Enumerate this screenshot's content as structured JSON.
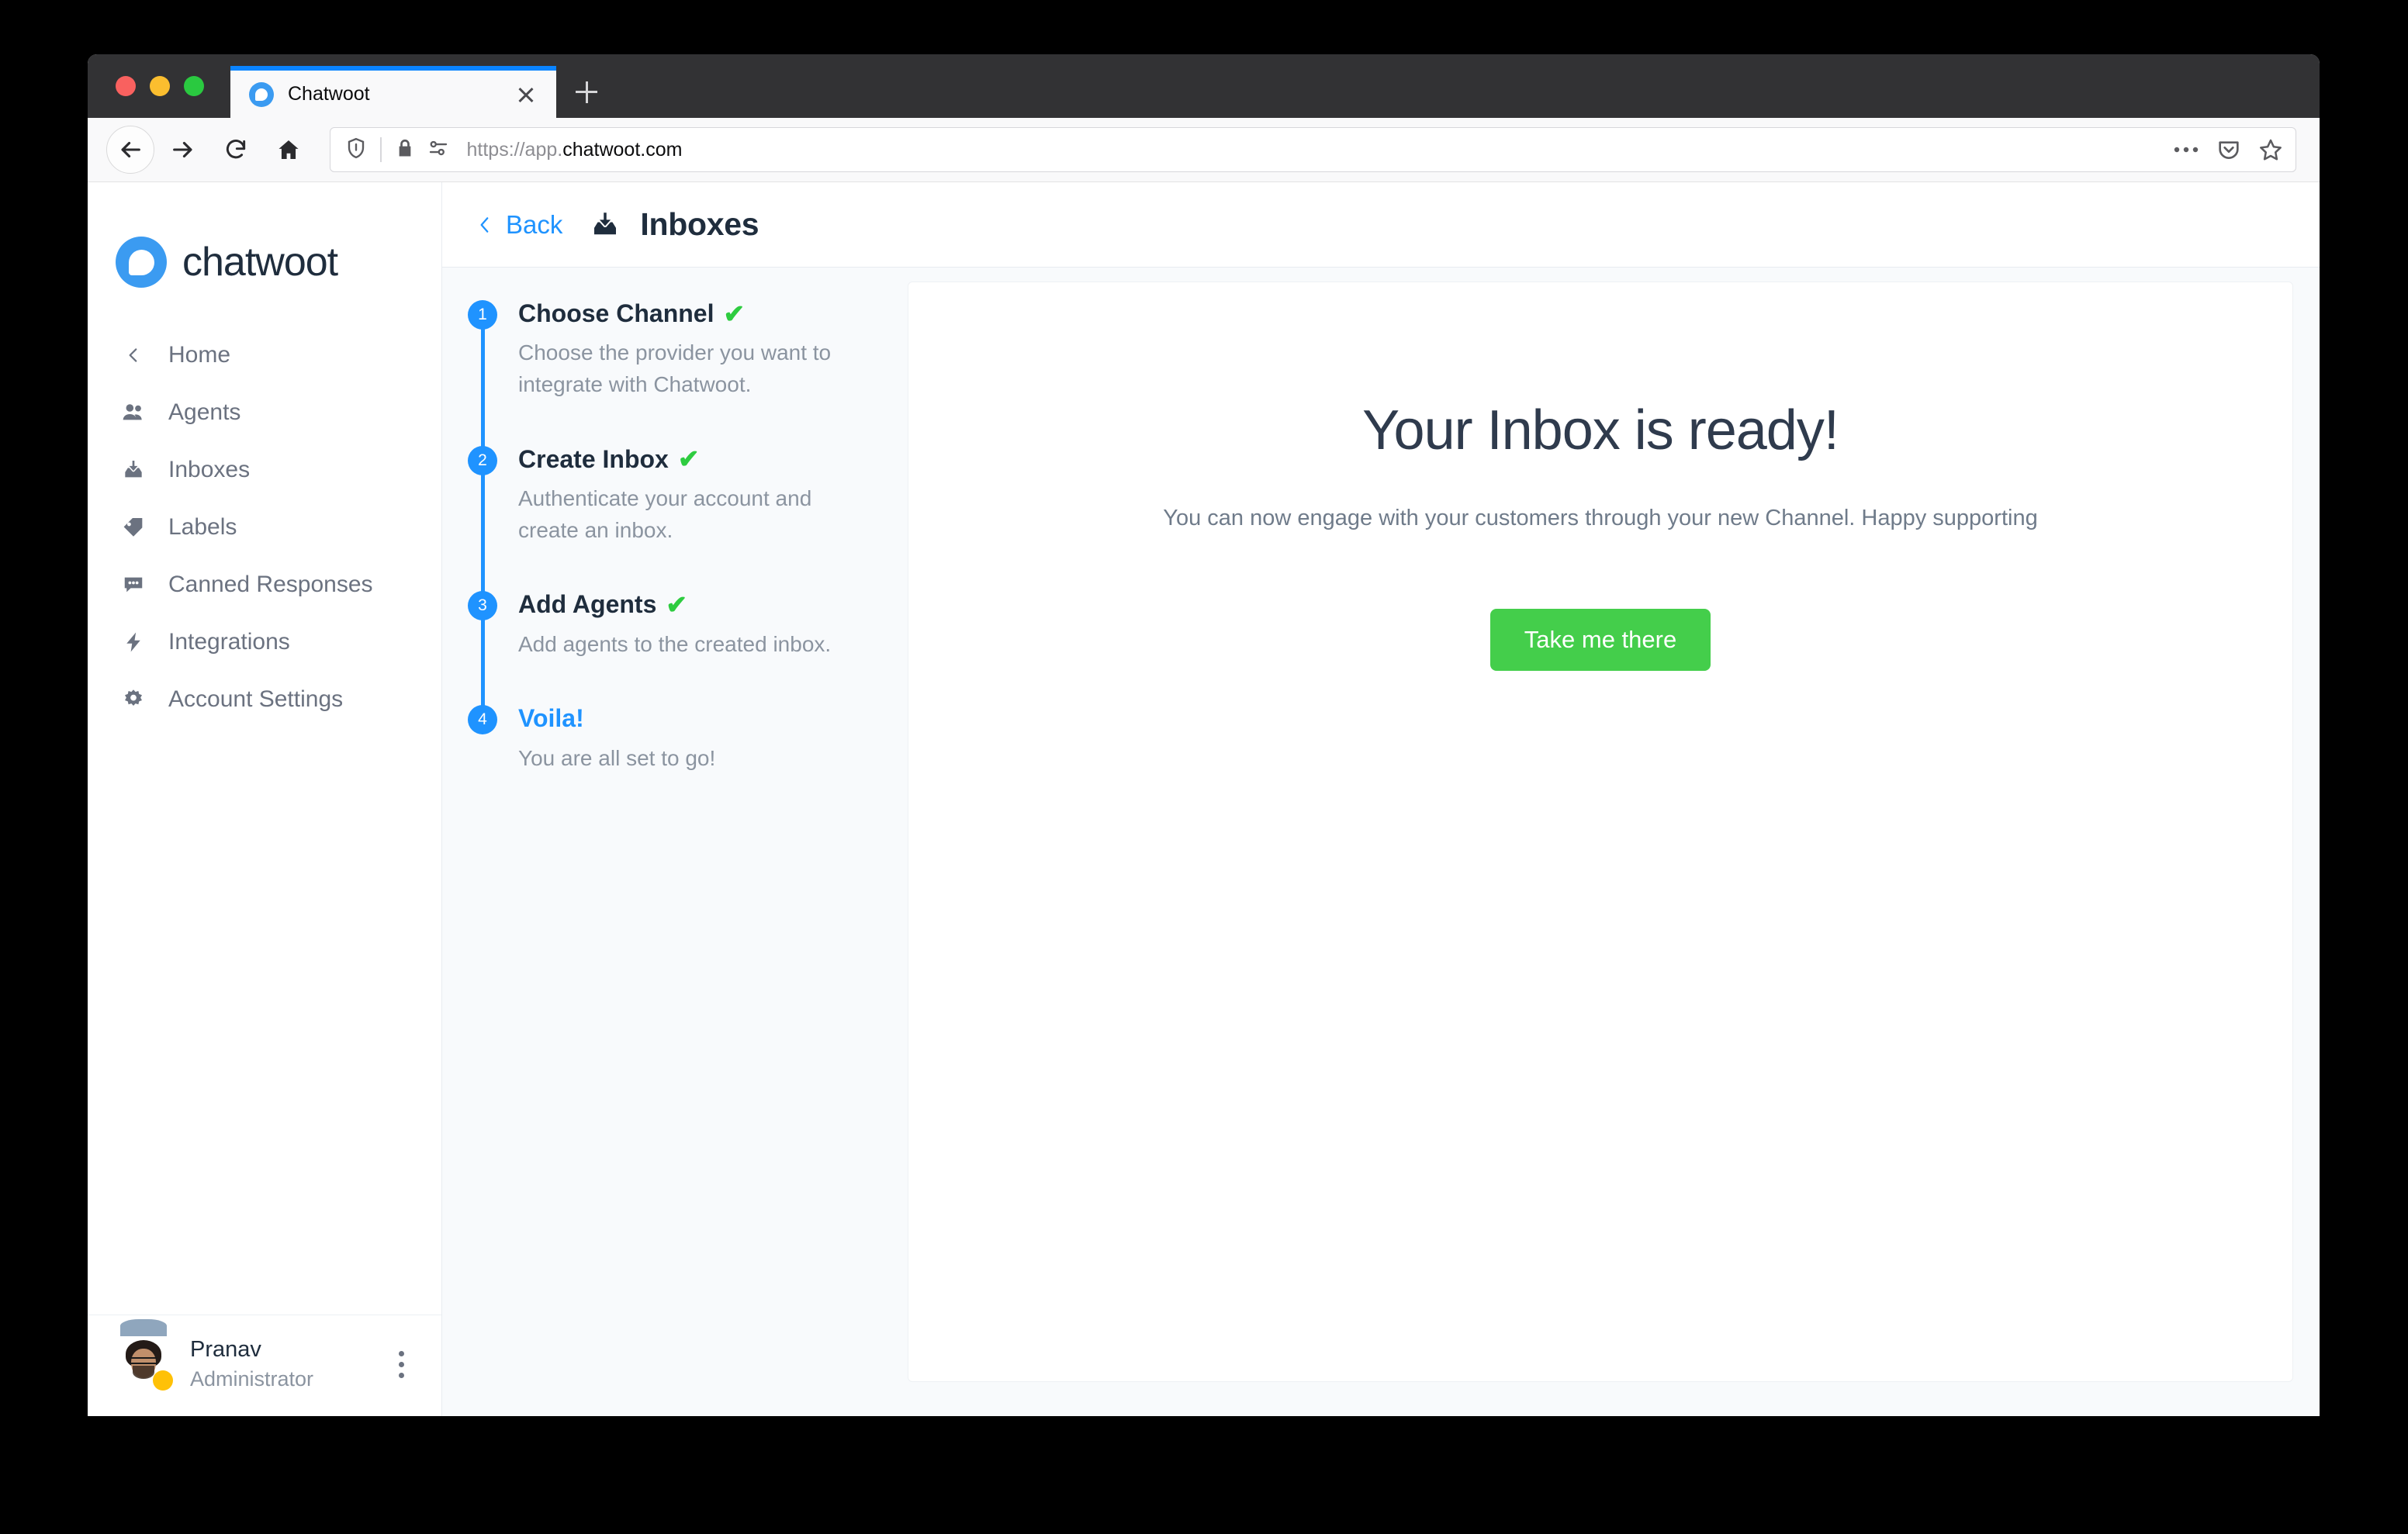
{
  "browser": {
    "tab": {
      "title": "Chatwoot",
      "favicon_icon": "chatwoot-logo-icon",
      "close_icon": "close-icon"
    },
    "new_tab_icon": "plus-icon",
    "nav": {
      "back_icon": "arrow-left-icon",
      "forward_icon": "arrow-right-icon",
      "reload_icon": "reload-icon",
      "home_icon": "home-icon"
    },
    "url": {
      "shield_icon": "shield-icon",
      "lock_icon": "lock-icon",
      "permissions_icon": "permissions-icon",
      "scheme": "https://app.",
      "domain": "chatwoot.com",
      "page_actions_icon": "ellipsis-icon",
      "pocket_icon": "pocket-icon",
      "bookmark_icon": "star-icon"
    },
    "window_controls": [
      "close",
      "minimize",
      "maximize"
    ]
  },
  "sidebar": {
    "brand": {
      "name": "chatwoot",
      "logo_icon": "chatwoot-logo-icon"
    },
    "items": [
      {
        "label": "Home",
        "icon": "chevron-left-icon"
      },
      {
        "label": "Agents",
        "icon": "people-icon"
      },
      {
        "label": "Inboxes",
        "icon": "inbox-icon"
      },
      {
        "label": "Labels",
        "icon": "tag-icon"
      },
      {
        "label": "Canned Responses",
        "icon": "chat-bubble-icon"
      },
      {
        "label": "Integrations",
        "icon": "lightning-icon"
      },
      {
        "label": "Account Settings",
        "icon": "gear-icon"
      }
    ],
    "profile": {
      "name": "Pranav",
      "role": "Administrator",
      "avatar_icon": "avatar",
      "status": "away",
      "status_color": "#ffc107",
      "menu_icon": "kebab-menu-icon"
    }
  },
  "header": {
    "back_label": "Back",
    "back_icon": "chevron-left-icon",
    "title_icon": "inbox-icon",
    "title": "Inboxes"
  },
  "wizard": {
    "steps": [
      {
        "number": "1",
        "title": "Choose Channel",
        "description": "Choose the provider you want to integrate with Chatwoot.",
        "completed": true,
        "active": false,
        "check_icon": "check-icon"
      },
      {
        "number": "2",
        "title": "Create Inbox",
        "description": "Authenticate your account and create an inbox.",
        "completed": true,
        "active": false,
        "check_icon": "check-icon"
      },
      {
        "number": "3",
        "title": "Add Agents",
        "description": "Add agents to the created inbox.",
        "completed": true,
        "active": false,
        "check_icon": "check-icon"
      },
      {
        "number": "4",
        "title": "Voila!",
        "description": "You are all set to go!",
        "completed": false,
        "active": true,
        "check_icon": ""
      }
    ]
  },
  "result": {
    "title": "Your Inbox is ready!",
    "subtitle": "You can now engage with your customers through your new Channel. Happy supporting",
    "cta_label": "Take me there",
    "cta_color": "#44ce4b"
  },
  "colors": {
    "accent_blue": "#1f93ff",
    "success_green": "#2ecc40",
    "brand_blue": "#3b9bf1",
    "text_dark": "#1f2d3d",
    "text_muted": "#8b94a0"
  }
}
